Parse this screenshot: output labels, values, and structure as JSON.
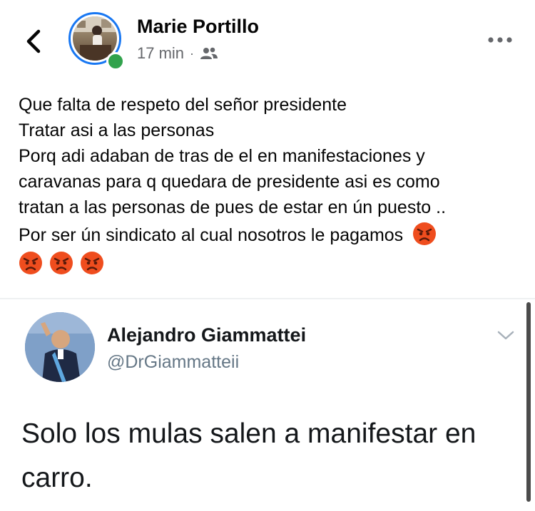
{
  "post": {
    "author": "Marie Portillo",
    "time": "17 min",
    "separator": "·",
    "privacy_icon": "friends-icon",
    "lines": [
      "Que falta de respeto del señor presidente",
      "Tratar asi a las personas",
      "Porq adi adaban de tras de el en manifestaciones y",
      "caravanas para q quedara de presidente asi es como",
      "tratan a las personas de pues de estar en ún puesto ..",
      "Por ser ún sindicato al cual nosotros le pagamos"
    ],
    "emoji": "angry-face-emoji",
    "accent_color": "#1877f2",
    "online_color": "#31a24c"
  },
  "tweet": {
    "name": "Alejandro Giammattei",
    "handle": "@DrGiammatteii",
    "text_lines": [
      "Solo los mulas salen a manifestar en",
      "carro."
    ]
  }
}
